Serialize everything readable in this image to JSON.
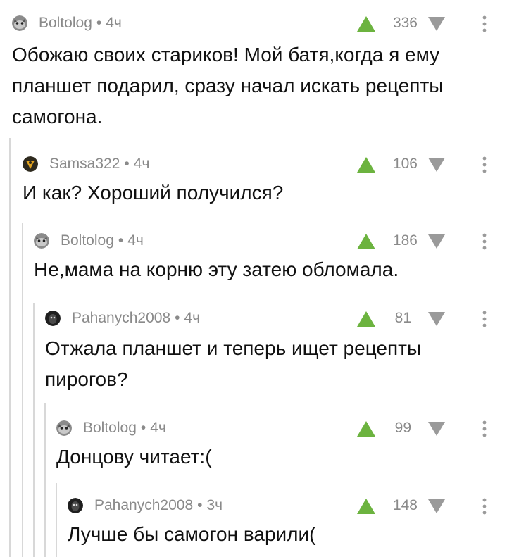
{
  "comments": [
    {
      "author": "Boltolog",
      "dot": "•",
      "time": "4ч",
      "rating": "336",
      "avatar": "cat-gray",
      "text_lines": [
        "Обожаю своих стариков! Мой батя,когда я ему",
        "планшет подарил, сразу начал искать рецепты",
        "самогона."
      ]
    },
    {
      "author": "Samsa322",
      "dot": "•",
      "time": "4ч",
      "rating": "106",
      "avatar": "samsa",
      "text_lines": [
        "И как? Хороший получился?"
      ]
    },
    {
      "author": "Boltolog",
      "dot": "•",
      "time": "4ч",
      "rating": "186",
      "avatar": "cat-gray",
      "text_lines": [
        "Не,мама на корню эту затею обломала."
      ]
    },
    {
      "author": "Pahanych2008",
      "dot": "•",
      "time": "4ч",
      "rating": "81",
      "avatar": "dark-face",
      "text_lines": [
        "Отжала планшет и теперь ищет рецепты",
        "пирогов?"
      ]
    },
    {
      "author": "Boltolog",
      "dot": "•",
      "time": "4ч",
      "rating": "99",
      "avatar": "cat-gray",
      "text_lines": [
        "Донцову читает:("
      ]
    },
    {
      "author": "Pahanych2008",
      "dot": "•",
      "time": "3ч",
      "rating": "148",
      "avatar": "dark-face",
      "text_lines": [
        "Лучше бы самогон варили("
      ]
    }
  ],
  "colors": {
    "upvote": "#6cb33f",
    "downvote": "#9a9a9a",
    "meta_text": "#8a8a8a",
    "thread_line": "#d8d8d8"
  }
}
